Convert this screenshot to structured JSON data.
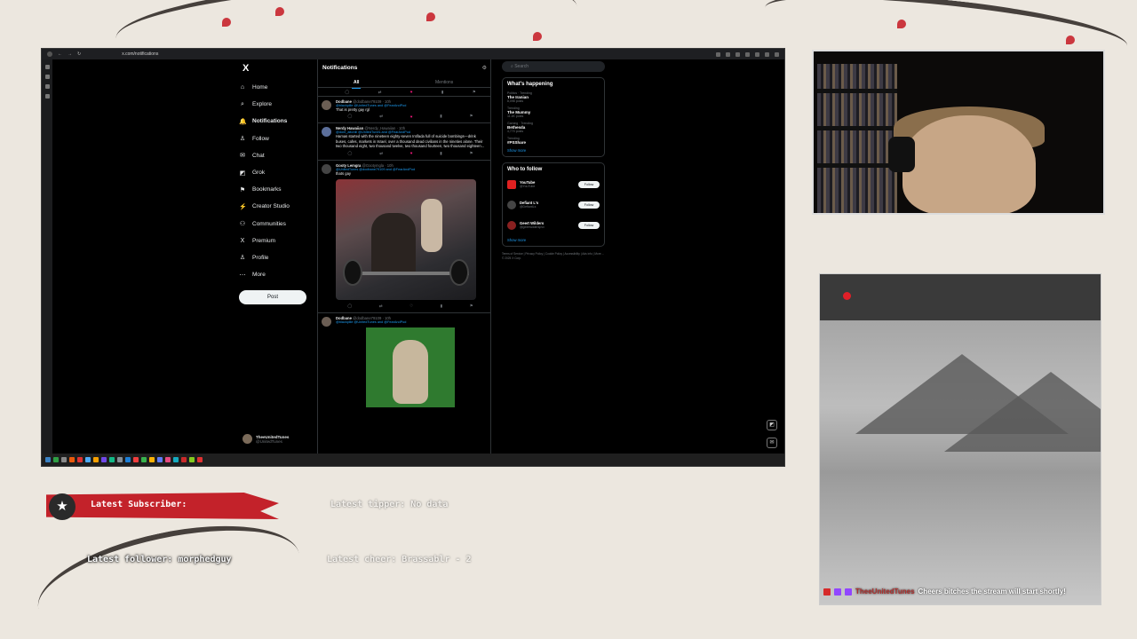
{
  "browser": {
    "url": "x.com/notifications"
  },
  "nav": {
    "logo": "X",
    "items": [
      {
        "icon": "⌂",
        "label": "Home"
      },
      {
        "icon": "⌕",
        "label": "Explore"
      },
      {
        "icon": "🔔",
        "label": "Notifications"
      },
      {
        "icon": "♙",
        "label": "Follow"
      },
      {
        "icon": "✉",
        "label": "Chat"
      },
      {
        "icon": "◩",
        "label": "Grok"
      },
      {
        "icon": "⚑",
        "label": "Bookmarks"
      },
      {
        "icon": "⚡",
        "label": "Creator Studio"
      },
      {
        "icon": "⚇",
        "label": "Communities"
      },
      {
        "icon": "X",
        "label": "Premium"
      },
      {
        "icon": "♙",
        "label": "Profile"
      },
      {
        "icon": "⋯",
        "label": "More"
      }
    ],
    "post_button": "Post",
    "account_name": "TheeUnitedTunes",
    "account_handle": "@UnitedTunes"
  },
  "feed": {
    "title": "Notifications",
    "tabs": [
      "All",
      "Mentions"
    ],
    "posts": [
      {
        "author": "Dodbane",
        "handle": "@dodbane79109 · 10h",
        "replying_to": "@blackpille @UnitedTunes and @FearAndPod",
        "text": "That is pretty gay rgl"
      },
      {
        "author": "Nerdy Hawaiian",
        "handle": "@Nerdy_Hawaiian · 10h",
        "replying_to": "@dont_altonill @UnitedTunes and @FearAndPod",
        "text": "Hamas started with the nineteen eighty-seven Intifada full of suicide bombings—drink buses, cafes, markets in Israel, over a thousand dead civilians in the nineties alone. Their two thousand eight, two thousand twelve, two thousand fourteen, two thousand eighteen..."
      },
      {
        "author": "Gooty Lemgra",
        "handle": "@Gootymgla · 10h",
        "replying_to": "@UnitedTunes @dodbane79109 and @FearAndPod",
        "text": "thats gay"
      },
      {
        "author": "Dodbane",
        "handle": "@dodbane79109 · 10h",
        "replying_to": "@blackpille @UnitedTunes and @FearAndPod",
        "text": ""
      }
    ]
  },
  "sidebar": {
    "search_placeholder": "Search",
    "happening_title": "What's happening",
    "trends": [
      {
        "meta": "Politics · Trending",
        "name": "The Iranian",
        "count": "8,098 posts"
      },
      {
        "meta": "Trending",
        "name": "The Mummy",
        "count": "11.4K posts"
      },
      {
        "meta": "Gaming · Trending",
        "name": "Bethesda",
        "count": "4,770 posts"
      },
      {
        "meta": "Trending",
        "name": "#PSShare",
        "count": ""
      }
    ],
    "show_more": "Show more",
    "follow_title": "Who to follow",
    "follows": [
      {
        "name": "YouTube",
        "handle": "@YouTube",
        "btn": "Follow"
      },
      {
        "name": "Defiant L's",
        "handle": "@DefiantLs",
        "btn": "Follow"
      },
      {
        "name": "Geert Wilders",
        "handle": "@geertwilderspvv",
        "btn": "Follow"
      }
    ],
    "footer": "Terms of Service | Privacy Policy | Cookie Policy | Accessibility | Ads info | More ... © 2025 X Corp."
  },
  "overlay": {
    "latest_subscriber": "Latest Subscriber:",
    "latest_tipper": "Latest tipper: No data",
    "latest_follower": "Latest follower: morphedguy",
    "latest_cheer": "Latest cheer: Brassablr - 2",
    "chat_user": "TheeUnitedTunes",
    "chat_message": "Cheers bitches the stream will start shortly!"
  },
  "colors": {
    "accent": "#1d9bf0",
    "like": "#f91880",
    "banner_red": "#c3222a"
  }
}
